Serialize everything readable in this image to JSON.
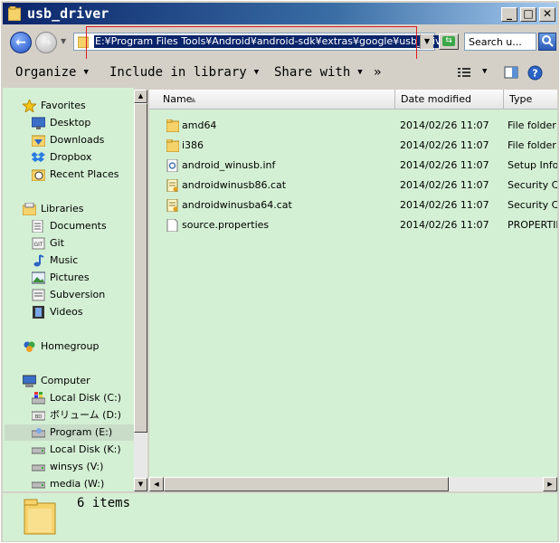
{
  "window": {
    "title": "usb_driver",
    "minimize_glyph": "_",
    "maximize_glyph": "□",
    "close_glyph": "✕"
  },
  "address": {
    "path": "E:¥Program Files Tools¥Android¥android-sdk¥extras¥google¥usb_driver",
    "search_placeholder": "Search u..."
  },
  "toolbar": {
    "organize": "Organize",
    "include_in_library": "Include in library",
    "share_with": "Share with",
    "more": "»"
  },
  "sidebar": {
    "favorites": "Favorites",
    "desktop": "Desktop",
    "downloads": "Downloads",
    "dropbox": "Dropbox",
    "recent_places": "Recent Places",
    "libraries": "Libraries",
    "documents": "Documents",
    "git": "Git",
    "music": "Music",
    "pictures": "Pictures",
    "subversion": "Subversion",
    "videos": "Videos",
    "homegroup": "Homegroup",
    "computer": "Computer",
    "local_disk_c": "Local Disk (C:)",
    "volume_d": "ボリューム (D:)",
    "program_e": "Program (E:)",
    "local_disk_k": "Local Disk (K:)",
    "winsys_v": "winsys (V:)",
    "media_w": "media (W:)"
  },
  "columns": {
    "name": "Name",
    "date_modified": "Date modified",
    "type": "Type"
  },
  "files": [
    {
      "name": "amd64",
      "date": "2014/02/26 11:07",
      "type": "File folder"
    },
    {
      "name": "i386",
      "date": "2014/02/26 11:07",
      "type": "File folder"
    },
    {
      "name": "android_winusb.inf",
      "date": "2014/02/26 11:07",
      "type": "Setup Information"
    },
    {
      "name": "androidwinusb86.cat",
      "date": "2014/02/26 11:07",
      "type": "Security Catalog"
    },
    {
      "name": "androidwinusba64.cat",
      "date": "2014/02/26 11:07",
      "type": "Security Catalog"
    },
    {
      "name": "source.properties",
      "date": "2014/02/26 11:07",
      "type": "PROPERTIES File"
    }
  ],
  "status": {
    "item_count": "6 items"
  },
  "colors": {
    "pane_background": "#d4f0d4",
    "title_bar": "#0a246a",
    "address_highlight": "#e0191d"
  }
}
